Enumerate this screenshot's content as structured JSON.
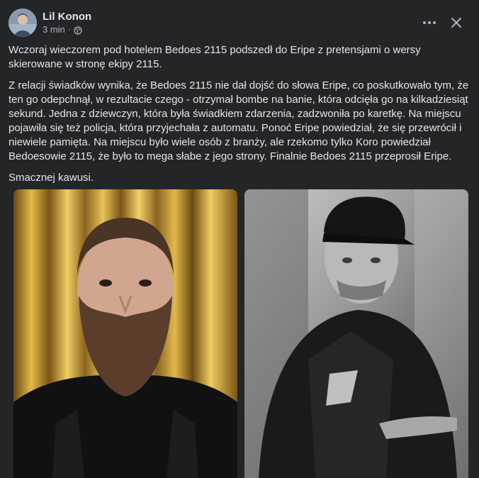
{
  "post": {
    "author": "Lil Konon",
    "time": "3 min",
    "separator": "·",
    "paragraphs": [
      "Wczoraj wieczorem pod hotelem Bedoes 2115 podszedł do Eripe z pretensjami o wersy skierowane w stronę ekipy 2115.",
      "Z relacji świadków wynika, że Bedoes 2115 nie dał dojść do słowa Eripe, co poskutkowało tym, że ten go odepchnął, w rezultacie czego - otrzymał bombe na banie, która odcięła go na kilkadziesiąt sekund. Jedna z dziewczyn, która była świadkiem zdarzenia, zadzwoniła po karetkę. Na miejscu pojawiła się też policja, która przyjechała z automatu. Ponoć Eripe powiedział, że się przewrócił i niewiele pamięta. Na miejscu było wiele osób z branży, ale rzekomo tylko Koro powiedział Bedoesowie 2115, że było to mega słabe z jego strony. Finalnie Bedoes 2115 przeprosił Eripe.",
      "Smacznej kawusi."
    ]
  },
  "icons": {
    "privacy": "globe-icon",
    "more": "more-horizontal-icon",
    "close": "close-icon"
  },
  "colors": {
    "background": "#242526",
    "primary_text": "#e4e6eb",
    "secondary_text": "#b0b3b8"
  }
}
